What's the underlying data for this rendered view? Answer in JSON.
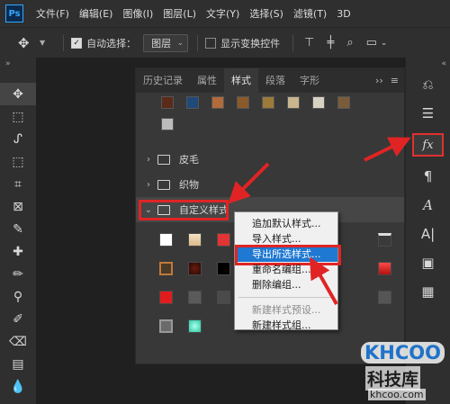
{
  "app": {
    "logo": "Ps"
  },
  "menu": [
    "文件(F)",
    "编辑(E)",
    "图像(I)",
    "图层(L)",
    "文字(Y)",
    "选择(S)",
    "滤镜(T)",
    "3D"
  ],
  "options": {
    "auto_select_label": "自动选择：",
    "auto_select_checked": true,
    "layer_select_value": "图层",
    "show_transform_label": "显示变换控件",
    "show_transform_checked": false
  },
  "panel": {
    "tabs": [
      "历史记录",
      "属性",
      "样式",
      "段落",
      "字形"
    ],
    "active_tab": "样式",
    "groups": [
      {
        "name": "皮毛",
        "expanded": false
      },
      {
        "name": "织物",
        "expanded": false
      },
      {
        "name": "自定义样式",
        "expanded": true,
        "selected": true
      }
    ]
  },
  "context_menu": {
    "items": [
      {
        "label": "追加默认样式...",
        "enabled": true
      },
      {
        "label": "导入样式...",
        "enabled": true
      },
      {
        "label": "导出所选样式...",
        "enabled": true,
        "highlighted": true
      },
      {
        "label": "重命名编组...",
        "enabled": true
      },
      {
        "label": "删除编组...",
        "enabled": true
      },
      {
        "label": "新建样式预设...",
        "enabled": false
      },
      {
        "label": "新建样式组...",
        "enabled": true
      }
    ]
  },
  "right_dock": [
    "history-icon",
    "adjustments-icon",
    "fx-icon",
    "paragraph-icon",
    "glyphs-icon",
    "character-icon",
    "swatches-icon",
    "layers-icon"
  ],
  "watermark": {
    "logo": "KHCOO",
    "brand": "科技库",
    "url": "khcoo.com"
  },
  "colors": {
    "highlight": "#e02424",
    "menu_selection": "#1f78d1",
    "ps_blue": "#31a8ff"
  }
}
